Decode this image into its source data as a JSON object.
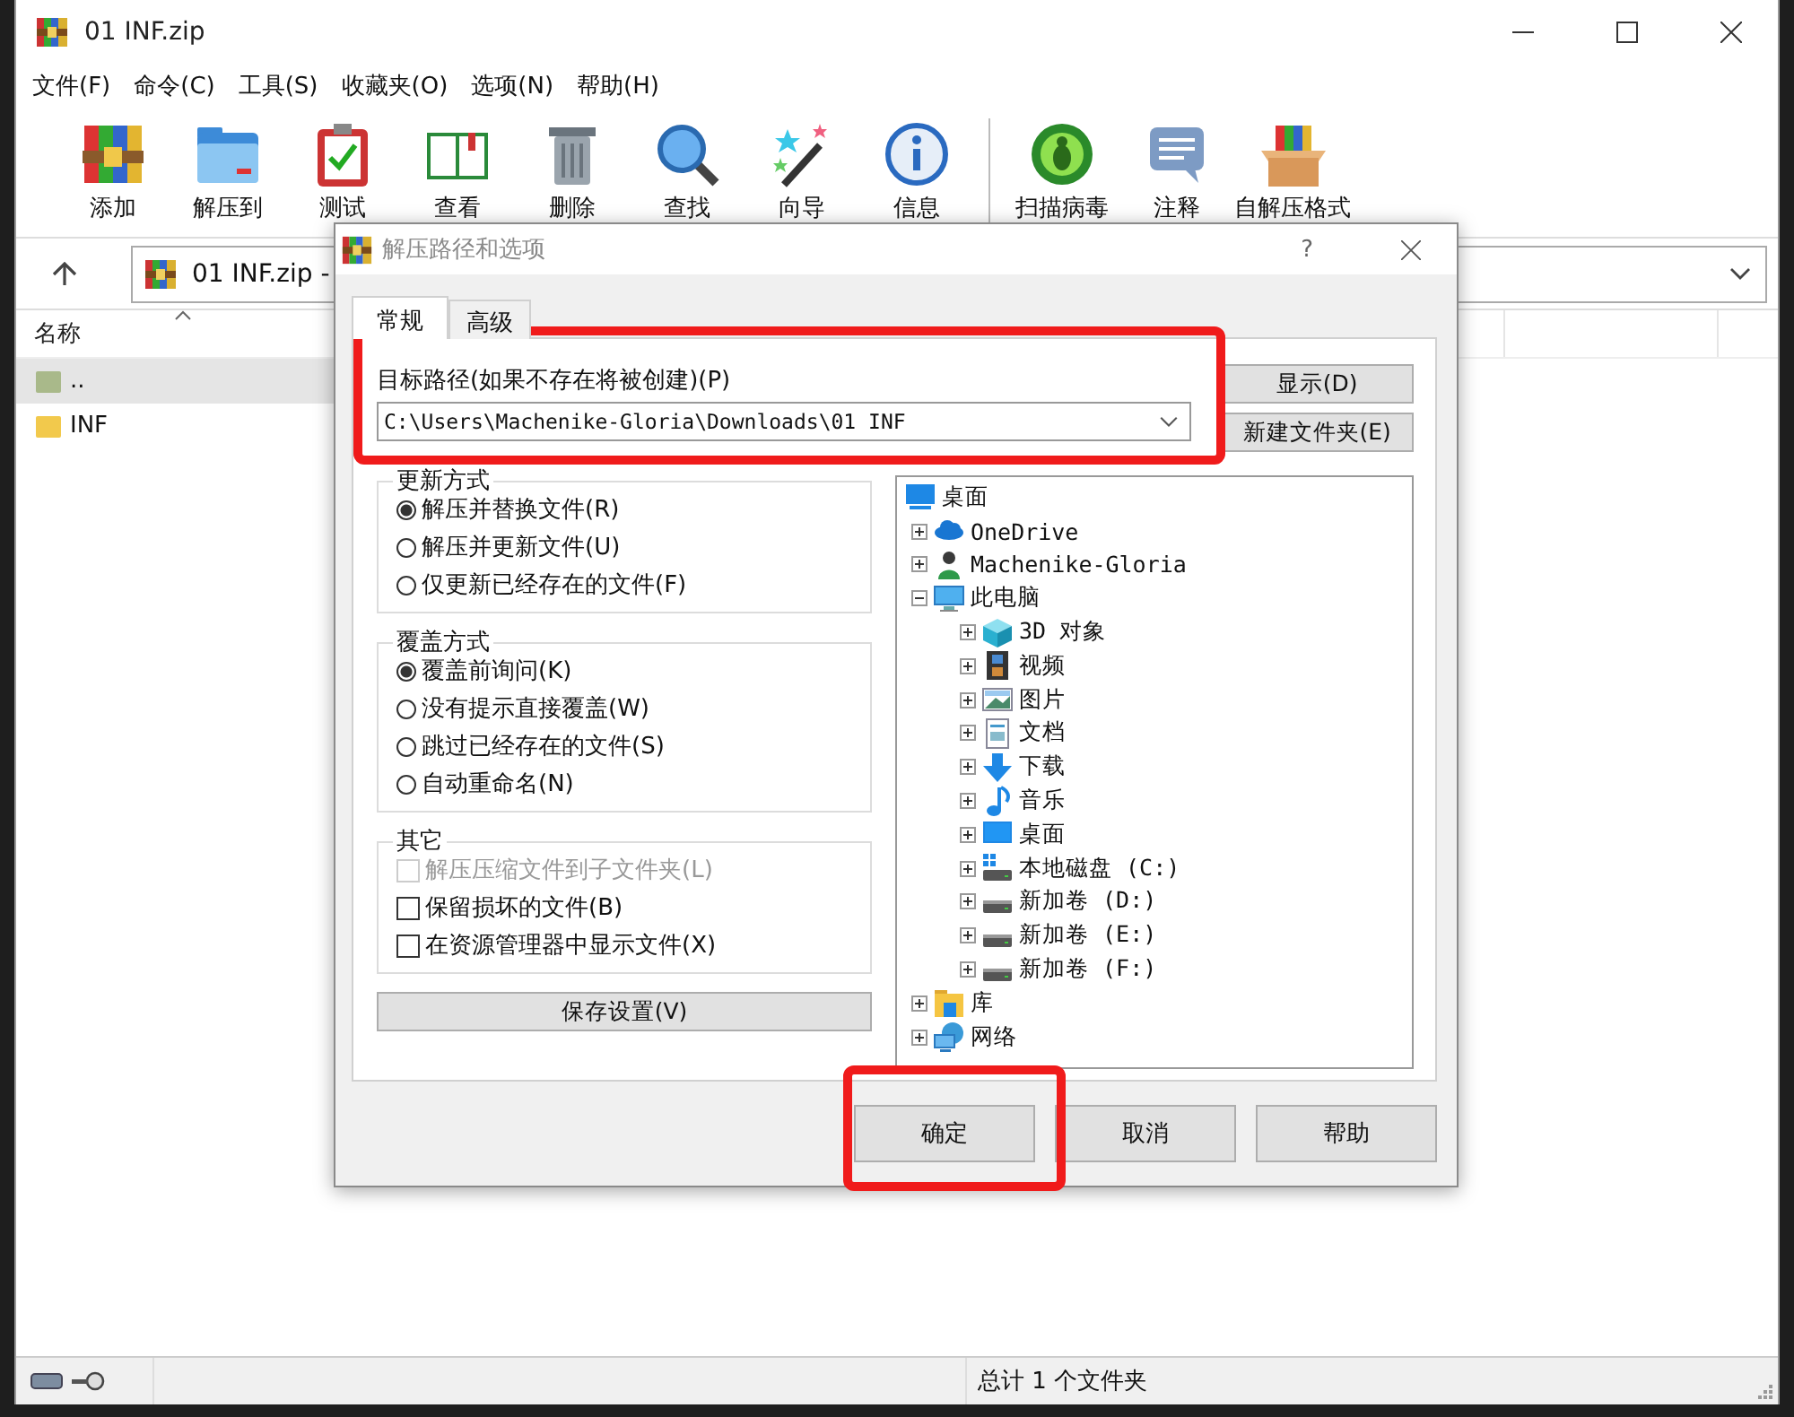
{
  "window": {
    "title": "01 INF.zip"
  },
  "menu": [
    "文件(F)",
    "命令(C)",
    "工具(S)",
    "收藏夹(O)",
    "选项(N)",
    "帮助(H)"
  ],
  "toolbar": {
    "groups": [
      [
        {
          "label": "添加"
        },
        {
          "label": "解压到"
        },
        {
          "label": "测试"
        },
        {
          "label": "查看"
        },
        {
          "label": "删除"
        },
        {
          "label": "查找"
        },
        {
          "label": "向导"
        },
        {
          "label": "信息"
        }
      ],
      [
        {
          "label": "扫描病毒"
        },
        {
          "label": "注释"
        },
        {
          "label": "自解压格式"
        }
      ]
    ]
  },
  "address_bar": {
    "path": "01 INF.zip -"
  },
  "file_list": {
    "columns": [
      "名称"
    ],
    "rows": [
      {
        "name": "..",
        "selected": true
      },
      {
        "name": "INF",
        "selected": false
      }
    ]
  },
  "status_bar": {
    "text": "总计 1 个文件夹"
  },
  "dialog": {
    "title": "解压路径和选项",
    "help": "?",
    "tabs": [
      {
        "label": "常规",
        "selected": true
      },
      {
        "label": "高级",
        "selected": false
      }
    ],
    "path_label": "目标路径(如果不存在将被创建)(P)",
    "path_value": "C:\\Users\\Machenike-Gloria\\Downloads\\01 INF",
    "side_buttons": [
      "显示(D)",
      "新建文件夹(E)"
    ],
    "update_mode": {
      "title": "更新方式",
      "options": [
        {
          "label": "解压并替换文件(R)",
          "selected": true
        },
        {
          "label": "解压并更新文件(U)",
          "selected": false
        },
        {
          "label": "仅更新已经存在的文件(F)",
          "selected": false
        }
      ]
    },
    "overwrite_mode": {
      "title": "覆盖方式",
      "options": [
        {
          "label": "覆盖前询问(K)",
          "selected": true
        },
        {
          "label": "没有提示直接覆盖(W)",
          "selected": false
        },
        {
          "label": "跳过已经存在的文件(S)",
          "selected": false
        },
        {
          "label": "自动重命名(N)",
          "selected": false
        }
      ]
    },
    "other": {
      "title": "其它",
      "options": [
        {
          "label": "解压压缩文件到子文件夹(L)",
          "checked": false,
          "disabled": true
        },
        {
          "label": "保留损坏的文件(B)",
          "checked": false,
          "disabled": false
        },
        {
          "label": "在资源管理器中显示文件(X)",
          "checked": false,
          "disabled": false
        }
      ]
    },
    "save_button": "保存设置(V)",
    "folder_tree": [
      {
        "label": "桌面",
        "children": [
          {
            "label": "OneDrive",
            "expanded": false
          },
          {
            "label": "Machenike-Gloria",
            "expanded": false
          },
          {
            "label": "此电脑",
            "expanded": true,
            "children": [
              {
                "label": "3D 对象",
                "expanded": false
              },
              {
                "label": "视频",
                "expanded": false
              },
              {
                "label": "图片",
                "expanded": false
              },
              {
                "label": "文档",
                "expanded": false
              },
              {
                "label": "下载",
                "expanded": false
              },
              {
                "label": "音乐",
                "expanded": false
              },
              {
                "label": "桌面",
                "expanded": false
              },
              {
                "label": "本地磁盘 (C:)",
                "expanded": false
              },
              {
                "label": "新加卷 (D:)",
                "expanded": false
              },
              {
                "label": "新加卷 (E:)",
                "expanded": false
              },
              {
                "label": "新加卷 (F:)",
                "expanded": false
              }
            ]
          },
          {
            "label": "库",
            "expanded": false
          },
          {
            "label": "网络",
            "expanded": false
          }
        ]
      }
    ],
    "buttons": [
      "确定",
      "取消",
      "帮助"
    ]
  }
}
